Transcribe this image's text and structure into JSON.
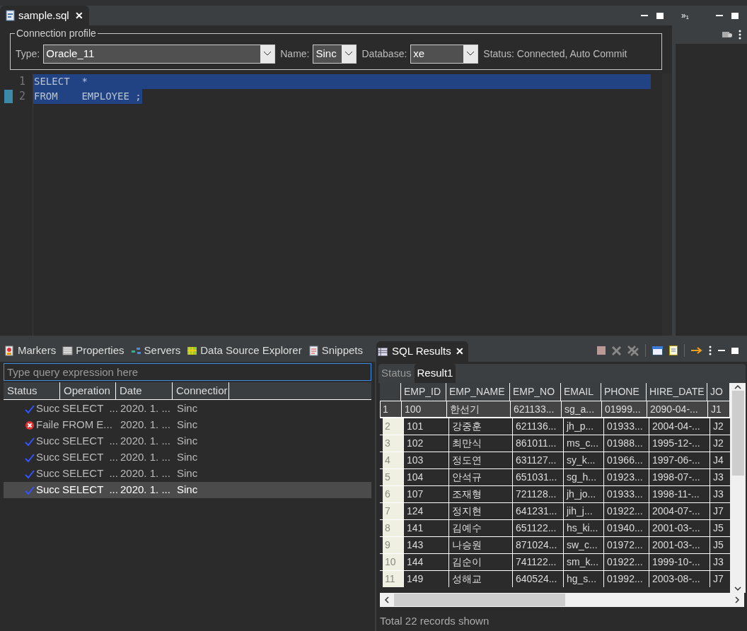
{
  "editor": {
    "tab": {
      "title": "sample.sql",
      "close": "✕"
    },
    "connection_profile": {
      "legend": "Connection profile",
      "type_label": "Type:",
      "type_value": "Oracle_11",
      "name_label": "Name:",
      "name_value": "Sinc",
      "database_label": "Database:",
      "database_value": "xe",
      "status": "Status: Connected, Auto Commit"
    },
    "lines": [
      {
        "number": "1",
        "code": "SELECT  *",
        "selected": true,
        "marker": false
      },
      {
        "number": "2",
        "code": "FROM    EMPLOYEE ;",
        "selected": true,
        "marker": true
      }
    ]
  },
  "side_panel": {
    "tab": "»₁"
  },
  "bottom_left": {
    "tabs": [
      "Markers",
      "Properties",
      "Servers",
      "Data Source Explorer",
      "Snippets"
    ],
    "filter": {
      "placeholder": "Type query expression here"
    },
    "columns": [
      "Status",
      "Operation",
      "Date",
      "Connectior"
    ],
    "rows": [
      {
        "kind": "success",
        "status": "Succ",
        "operation": "SELECT  ...",
        "date": "2020. 1. ...",
        "connection": "Sinc",
        "selected": false
      },
      {
        "kind": "failed",
        "status": "Faile",
        "operation": "FROM E...",
        "date": "2020. 1. ...",
        "connection": "Sinc",
        "selected": false
      },
      {
        "kind": "success",
        "status": "Succ",
        "operation": "SELECT  ...",
        "date": "2020. 1. ...",
        "connection": "Sinc",
        "selected": false
      },
      {
        "kind": "success",
        "status": "Succ",
        "operation": "SELECT  ...",
        "date": "2020. 1. ...",
        "connection": "Sinc",
        "selected": false
      },
      {
        "kind": "success",
        "status": "Succ",
        "operation": "SELECT  ...",
        "date": "2020. 1. ...",
        "connection": "Sinc",
        "selected": false
      },
      {
        "kind": "success",
        "status": "Succ",
        "operation": "SELECT  ...",
        "date": "2020. 1. ...",
        "connection": "Sinc",
        "selected": true
      }
    ]
  },
  "sql_results": {
    "tab": "SQL Results",
    "close": "✕",
    "subtabs": [
      {
        "label": "Status",
        "selected": false
      },
      {
        "label": "Result1",
        "selected": true
      }
    ],
    "columns": [
      "EMP_ID",
      "EMP_NAME",
      "EMP_NO",
      "EMAIL",
      "PHONE",
      "HIRE_DATE",
      "JO"
    ],
    "rows": [
      {
        "number": "1",
        "selected": true,
        "cells": [
          "100",
          "한선기",
          "621133...",
          "sg_a...",
          "01999...",
          "2090-04-...",
          "J1"
        ]
      },
      {
        "number": "2",
        "selected": false,
        "cells": [
          "101",
          "강중훈",
          "621136...",
          "jh_p...",
          "01933...",
          "2004-04-...",
          "J2"
        ]
      },
      {
        "number": "3",
        "selected": false,
        "cells": [
          "102",
          "최만식",
          "861011...",
          "ms_c...",
          "01988...",
          "1995-12-...",
          "J2"
        ]
      },
      {
        "number": "4",
        "selected": false,
        "cells": [
          "103",
          "정도연",
          "631127...",
          "sy_k...",
          "01966...",
          "1997-06-...",
          "J4"
        ]
      },
      {
        "number": "5",
        "selected": false,
        "cells": [
          "104",
          "안석규",
          "651031...",
          "sg_h...",
          "01923...",
          "1998-07-...",
          "J3"
        ]
      },
      {
        "number": "6",
        "selected": false,
        "cells": [
          "107",
          "조재형",
          "721128...",
          "jh_jo...",
          "01933...",
          "1998-11-...",
          "J3"
        ]
      },
      {
        "number": "7",
        "selected": false,
        "cells": [
          "124",
          "정지현",
          "641231...",
          "jih_j...",
          "01922...",
          "2004-07-...",
          "J7"
        ]
      },
      {
        "number": "8",
        "selected": false,
        "cells": [
          "141",
          "김예수",
          "651122...",
          "hs_ki...",
          "01940...",
          "2001-03-...",
          "J5"
        ]
      },
      {
        "number": "9",
        "selected": false,
        "cells": [
          "143",
          "나승원",
          "871024...",
          "sw_c...",
          "01972...",
          "2001-03-...",
          "J5"
        ]
      },
      {
        "number": "10",
        "selected": false,
        "cells": [
          "144",
          "김순이",
          "741122...",
          "sm_k...",
          "01922...",
          "1999-10-...",
          "J3"
        ]
      },
      {
        "number": "11",
        "selected": false,
        "cells": [
          "149",
          "성해교",
          "640524...",
          "hg_s...",
          "01992...",
          "2003-08-...",
          "J7"
        ]
      }
    ],
    "footer": "Total 22 records shown"
  }
}
